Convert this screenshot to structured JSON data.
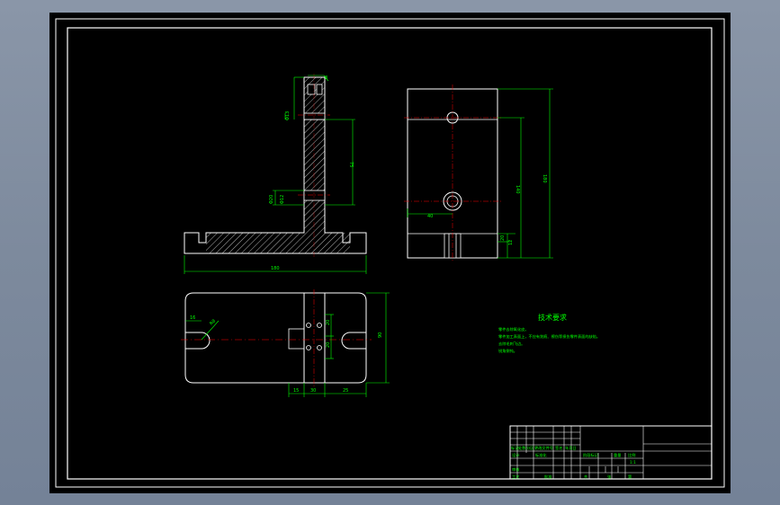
{
  "dimensions": {
    "front_width": "180",
    "front_height": "75",
    "front_slot_width": "8",
    "front_hole_top": "Φ13",
    "front_hole_bottom": "Φ20",
    "front_hole_bottom_inner": "Φ12",
    "side_height_total": "180",
    "side_height_hole": "140",
    "side_h1": "20",
    "side_h2": "12",
    "side_hole_offset": "40",
    "top_slot_w": "16",
    "top_radius": "R8",
    "top_spacing1": "20",
    "top_spacing2": "20",
    "top_depth": "90",
    "top_bottom_1": "15",
    "top_bottom_2": "30",
    "top_bottom_3": "25"
  },
  "technical_requirements": {
    "title": "技术要求",
    "lines": [
      "零件去除氧化皮。",
      "零件加工表面上，不应有划痕、擦伤等损伤零件表面的缺陷。",
      "去除毛刺飞边。",
      "锐角倒钝。"
    ]
  },
  "title_block": {
    "row_labels": [
      "标记",
      "处数",
      "分区",
      "更改文件号",
      "签名",
      "年月日"
    ],
    "design_label": "设计",
    "standard_label": "标准化",
    "stage_label": "阶段标记",
    "weight_label": "重量",
    "scale_label": "比例",
    "scale_value": "1:1",
    "review_label": "审核",
    "process_label": "工艺",
    "approve_label": "批准",
    "sheet_label": "共",
    "sheet_of": "张",
    "page_label": "第"
  },
  "colors": {
    "background": "#000000",
    "outline": "#ffffff",
    "dimension": "#00ff00",
    "centerline": "#ff0000",
    "hatch": "#ffffff"
  }
}
